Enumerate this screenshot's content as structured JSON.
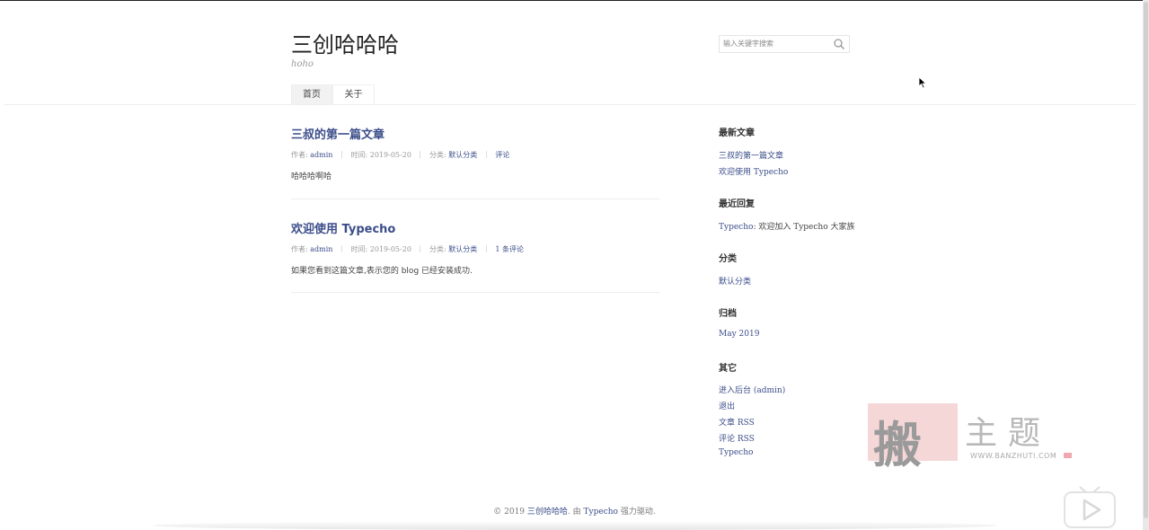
{
  "site": {
    "title": "三创哈哈哈",
    "description": "hoho"
  },
  "search": {
    "placeholder": "输入关键字搜索"
  },
  "nav": {
    "home": "首页",
    "about": "关于"
  },
  "posts": [
    {
      "title": "三叔的第一篇文章",
      "author_label": "作者:",
      "author": "admin",
      "time_label": "时间:",
      "time": "2019-05-20",
      "category_label": "分类:",
      "category": "默认分类",
      "comments": "评论",
      "excerpt": "哈哈哈啊哈"
    },
    {
      "title": "欢迎使用 Typecho",
      "author_label": "作者:",
      "author": "admin",
      "time_label": "时间:",
      "time": "2019-05-20",
      "category_label": "分类:",
      "category": "默认分类",
      "comments": "1 条评论",
      "excerpt": "如果您看到这篇文章,表示您的 blog 已经安装成功."
    }
  ],
  "sidebar": {
    "recent_posts": {
      "title": "最新文章",
      "items": [
        "三叔的第一篇文章",
        "欢迎使用 Typecho"
      ]
    },
    "recent_comments": {
      "title": "最近回复",
      "author": "Typecho",
      "text": ": 欢迎加入 Typecho 大家族"
    },
    "categories": {
      "title": "分类",
      "items": [
        "默认分类"
      ]
    },
    "archives": {
      "title": "归档",
      "items": [
        "May 2019"
      ]
    },
    "other": {
      "title": "其它",
      "items": [
        "进入后台 (admin)",
        "退出",
        "文章 RSS",
        "评论 RSS",
        "Typecho"
      ]
    }
  },
  "footer": {
    "copyright": "© 2019",
    "site_link": "三创哈哈哈",
    "by": ". 由",
    "typecho_link": "Typecho",
    "powered": "强力驱动."
  },
  "watermark": {
    "glyph": "搬",
    "text": "主题",
    "url": "WWW.BANZHUTI.COM"
  },
  "colors": {
    "link": "#3b4d8a",
    "text": "#444444",
    "muted": "#999999"
  }
}
